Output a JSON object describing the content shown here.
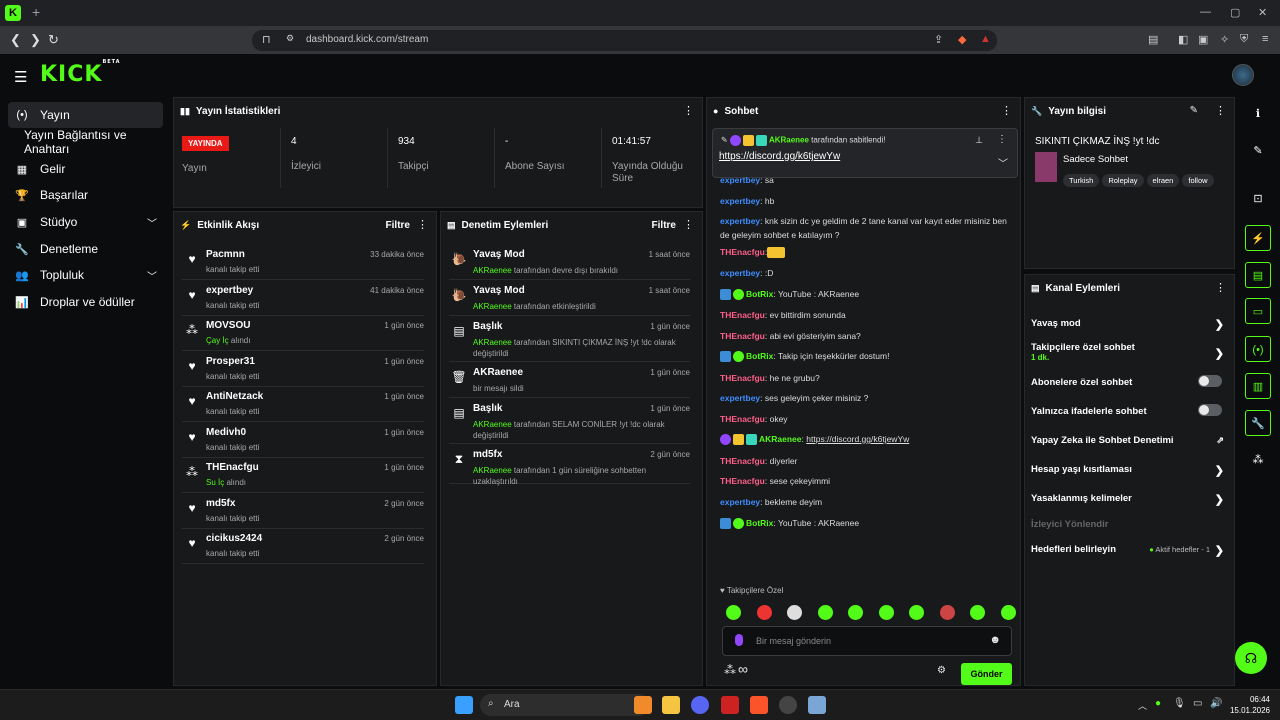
{
  "browser": {
    "url": "dashboard.kick.com/stream"
  },
  "sidebar": {
    "items": [
      {
        "label": "Yayın",
        "icon": "(•)"
      },
      {
        "label": "Yayın Bağlantısı ve Anahtarı",
        "icon": ""
      },
      {
        "label": "Gelir",
        "icon": "▦"
      },
      {
        "label": "Başarılar",
        "icon": "🏆"
      },
      {
        "label": "Stüdyo",
        "icon": "▣"
      },
      {
        "label": "Denetleme",
        "icon": "🔧"
      },
      {
        "label": "Topluluk",
        "icon": "👥"
      },
      {
        "label": "Droplar ve ödüller",
        "icon": "📊"
      }
    ]
  },
  "stats": {
    "title": "Yayın İstatistikleri",
    "live_badge": "YAYINDA",
    "live_label": "Yayın",
    "viewers_value": "4",
    "viewers_label": "İzleyici",
    "followers_value": "934",
    "followers_label": "Takipçi",
    "subs_value": "-",
    "subs_label": "Abone Sayısı",
    "uptime_value": "01:41:57",
    "uptime_label": "Yayında Olduğu Süre"
  },
  "activity": {
    "title": "Etkinlik Akışı",
    "filter": "Filtre",
    "rows": [
      {
        "name": "Pacmnn",
        "sub": "kanalı takip etti",
        "time": "33 dakika önce",
        "icon": "♥"
      },
      {
        "name": "expertbey",
        "sub": "kanalı takip etti",
        "time": "41 dakika önce",
        "icon": "♥"
      },
      {
        "name": "MOVSOU",
        "sub_green": "Çay İç",
        "sub": " alındı",
        "time": "1 gün önce",
        "icon": "⁂"
      },
      {
        "name": "Prosper31",
        "sub": "kanalı takip etti",
        "time": "1 gün önce",
        "icon": "♥"
      },
      {
        "name": "AntiNetzack",
        "sub": "kanalı takip etti",
        "time": "1 gün önce",
        "icon": "♥"
      },
      {
        "name": "Medivh0",
        "sub": "kanalı takip etti",
        "time": "1 gün önce",
        "icon": "♥"
      },
      {
        "name": "THEnacfgu",
        "sub_green": "Su İç",
        "sub": " alındı",
        "time": "1 gün önce",
        "icon": "⁂"
      },
      {
        "name": "md5fx",
        "sub": "kanalı takip etti",
        "time": "2 gün önce",
        "icon": "♥"
      },
      {
        "name": "cicikus2424",
        "sub": "kanalı takip etti",
        "time": "2 gün önce",
        "icon": "♥"
      }
    ]
  },
  "moderation": {
    "title": "Denetim Eylemleri",
    "filter": "Filtre",
    "rows": [
      {
        "name": "Yavaş Mod",
        "actor": "AKRaenee",
        "sub": " tarafından devre dışı bırakıldı",
        "time": "1 saat önce",
        "icon": "🐌"
      },
      {
        "name": "Yavaş Mod",
        "actor": "AKRaenee",
        "sub": " tarafından etkinleştirildi",
        "time": "1 saat önce",
        "icon": "🐌"
      },
      {
        "name": "Başlık",
        "actor": "AKRaenee",
        "sub": " tarafından SIKINTI ÇIKMAZ İNŞ !yt !dc olarak değiştirildi",
        "time": "1 gün önce",
        "icon": "▤"
      },
      {
        "name": "AKRaenee",
        "actor": "",
        "sub": "bir mesajı sildi",
        "time": "1 gün önce",
        "icon": "🗑"
      },
      {
        "name": "Başlık",
        "actor": "AKRaenee",
        "sub": " tarafından SELAM CONİLER !yt !dc olarak değiştirildi",
        "time": "1 gün önce",
        "icon": "▤"
      },
      {
        "name": "md5fx",
        "actor": "AKRaenee",
        "sub": " tarafından 1 gün süreliğine sohbetten uzaklaştırıldı",
        "time": "2 gün önce",
        "icon": "⧗"
      }
    ]
  },
  "chat": {
    "title": "Sohbet",
    "pinned_user": "AKRaenee",
    "pinned_suffix": " tarafından sabitlendi!",
    "pinned_link": "https://discord.gg/k6tjewYw",
    "followers_only": "Takipçilere Özel",
    "placeholder": "Bir mesaj gönderin",
    "send": "Gönder",
    "messages": [
      {
        "user": "expertbey",
        "color": "blue",
        "text": ": sa",
        "badges": ""
      },
      {
        "user": "expertbey",
        "color": "blue",
        "text": ": hb",
        "badges": ""
      },
      {
        "user": "expertbey",
        "color": "blue",
        "text": ": knk sizin dc ye geldim de 2 tane kanal var kayıt eder misiniz ben de geleyim sohbet e katılayım ?",
        "badges": ""
      },
      {
        "user": "THEnacfgu",
        "color": "pink",
        "text": ":",
        "badges": ""
      },
      {
        "user": "expertbey",
        "color": "blue",
        "text": ": :D",
        "badges": ""
      },
      {
        "user": "BotRix",
        "color": "green",
        "text": ": YouTube : AKRaenee",
        "badges": "bot"
      },
      {
        "user": "THEnacfgu",
        "color": "pink",
        "text": ": ev bittirdim sonunda",
        "badges": ""
      },
      {
        "user": "THEnacfgu",
        "color": "pink",
        "text": ": abi evi gösteriyim sana?",
        "badges": ""
      },
      {
        "user": "BotRix",
        "color": "green",
        "text": ": Takip için teşekkürler dostum!",
        "badges": "bot"
      },
      {
        "user": "THEnacfgu",
        "color": "pink",
        "text": ": he ne grubu?",
        "badges": ""
      },
      {
        "user": "expertbey",
        "color": "blue",
        "text": ": ses geleyim çeker misiniz ?",
        "badges": ""
      },
      {
        "user": "THEnacfgu",
        "color": "pink",
        "text": ": okey",
        "badges": ""
      },
      {
        "user": "AKRaenee",
        "color": "green",
        "text": ": ",
        "link": "https://discord.gg/k6tjewYw",
        "badges": "owner"
      },
      {
        "user": "THEnacfgu",
        "color": "pink",
        "text": ": diyerler",
        "badges": ""
      },
      {
        "user": "THEnacfgu",
        "color": "pink",
        "text": ": sese çekeyimmi",
        "badges": ""
      },
      {
        "user": "expertbey",
        "color": "blue",
        "text": ": bekleme deyim",
        "badges": ""
      },
      {
        "user": "BotRix",
        "color": "green",
        "text": ": YouTube : AKRaenee",
        "badges": "bot"
      }
    ]
  },
  "stream_info": {
    "title": "Yayın bilgisi",
    "stream_title": "SIKINTI ÇIKMAZ İNŞ !yt !dc",
    "category": "Sadece Sohbet",
    "tags": [
      "Turkish",
      "Roleplay",
      "elraen",
      "follow"
    ]
  },
  "channel_actions": {
    "title": "Kanal Eylemleri",
    "rows": [
      {
        "label": "Yavaş mod",
        "control": "chevron"
      },
      {
        "label": "Takipçilere özel sohbet",
        "sub": "1 dk.",
        "control": "chevron"
      },
      {
        "label": "Abonelere özel sohbet",
        "control": "toggle"
      },
      {
        "label": "Yalnızca ifadelerle sohbet",
        "control": "toggle"
      },
      {
        "label": "Yapay Zeka ile Sohbet Denetimi",
        "control": "external"
      },
      {
        "label": "Hesap yaşı kısıtlaması",
        "control": "chevron"
      },
      {
        "label": "Yasaklanmış kelimeler",
        "control": "chevron"
      },
      {
        "label": "İzleyici Yönlendir",
        "control": "none",
        "disabled": true
      },
      {
        "label": "Hedefleri belirleyin",
        "status": "Aktif hedefler - 1",
        "control": "chevron"
      }
    ]
  },
  "taskbar": {
    "search": "Ara",
    "time": "06:44",
    "date": "15.01.2026"
  },
  "colors": {
    "accent": "#53fc18",
    "live": "#e91916",
    "panel": "#18191b"
  }
}
